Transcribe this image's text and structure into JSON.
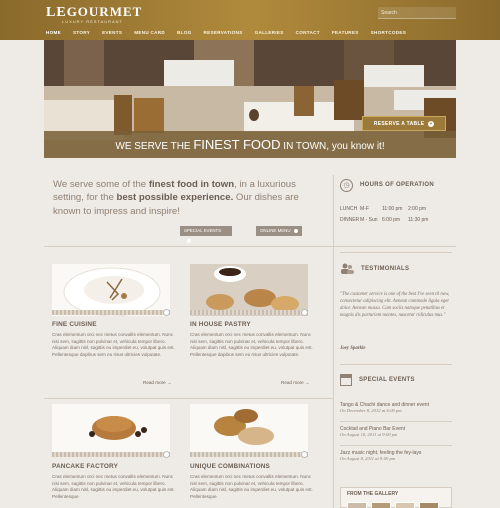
{
  "header": {
    "logo_le": "LE",
    "logo_rest": "GOURMET",
    "tagline": "LUXURY RESTAURANT",
    "search_placeholder": "Search"
  },
  "nav": [
    "HOME",
    "STORY",
    "EVENTS",
    "MENU CARD",
    "BLOG",
    "RESERVATIONS",
    "GALLERIES",
    "CONTACT",
    "FEATURES",
    "SHORTCODES"
  ],
  "hero": {
    "reserve_label": "RESERVE A TABLE",
    "banner_1": "WE SERVE THE ",
    "banner_big": "FINEST FOOD",
    "banner_2": " IN TOWN, you know it!"
  },
  "intro": {
    "p1": "We serve some of the ",
    "b1": "finest food in town",
    "p2": ", in a luxurious setting, for the ",
    "b2": "best possible experience.",
    "p3": " Our dishes are known to impress and inspire!",
    "btn1": "SPECIAL EVENTS",
    "btn2": "ONLINE MENU"
  },
  "hours": {
    "title": "HOURS OF OPERATION",
    "rows": [
      {
        "name": "LUNCH",
        "days": "M-F",
        "open": "11:00 pm",
        "close": "2:00 pm"
      },
      {
        "name": "DINNER",
        "days": "M - Sun",
        "open": "6:00 pm",
        "close": "11:30 pm"
      }
    ]
  },
  "cards": [
    {
      "title": "FINE CUISINE",
      "text": "Cras elementum orci nec metus convallis elementum. Nunc nisi sem, sagittis non pulvinar et, vehicula tempor libero. Aliquam diam nisl, sagittis eu imperdiet eu, volutpat quis est. Pellentesque dapibus sem eu risus ultricies vulputate.",
      "more": ""
    },
    {
      "title": "IN HOUSE PASTRY",
      "text": "Cras elementum orci nec metus convallis elementum. Nunc nisi sem, sagittis non pulvinar et, vehicula tempor libero. Aliquam diam nisl, sagittis eu imperdiet eu, volutpat quis est. Pellentesque dapibus sem eu risus ultricies vulputate.",
      "more": "Read more →"
    },
    {
      "title": "PANCAKE FACTORY",
      "text": "Cras elementum orci nec metus convallis elementum. Nunc nisi sem, sagittis non pulvinar et, vehicula tempor libero. Aliquam diam nisl, sagittis eu imperdiet eu, volutpat quis est. Pellentesque",
      "more": ""
    },
    {
      "title": "UNIQUE COMBINATIONS",
      "text": "Cras elementum orci nec metus convallis elementum. Nunc nisi sem, sagittis non pulvinar et, vehicula tempor libero. Aliquam diam nisl, sagittis eu imperdiet eu, volutpat quis est. Pellentesque",
      "more": ""
    }
  ],
  "read_more_1": "Read more →",
  "testimonials": {
    "title": "TESTIMONIALS",
    "text": "\"The customer service is one of the best I've seen til now, consectetur adipiscing elit. Aenean commodo ligula eget dolor. Aenean massa. Cum sociis natoque penatibus et magnis dis parturient montes, nascetur ridiculus mus.\"",
    "author": "Joey Sparkle"
  },
  "events": {
    "title": "SPECIAL EVENTS",
    "items": [
      {
        "title": "Tango & Chachi dance and dinner event",
        "date": "On   December 8, 2012   at 6:00 pm"
      },
      {
        "title": "Cocktail and Piano Bar Event",
        "date": "On   August 10, 2011   at 9:00 pm"
      },
      {
        "title": "Jazz music night, feeling the fey-lays",
        "date": "On   August 8, 2011   at 9:00 pm"
      }
    ]
  },
  "gallery": {
    "title": "FROM THE GALLERY"
  },
  "colors": {
    "brand": "#9b7a3a",
    "header": "#b08a3c",
    "bg": "#eeeae6"
  }
}
